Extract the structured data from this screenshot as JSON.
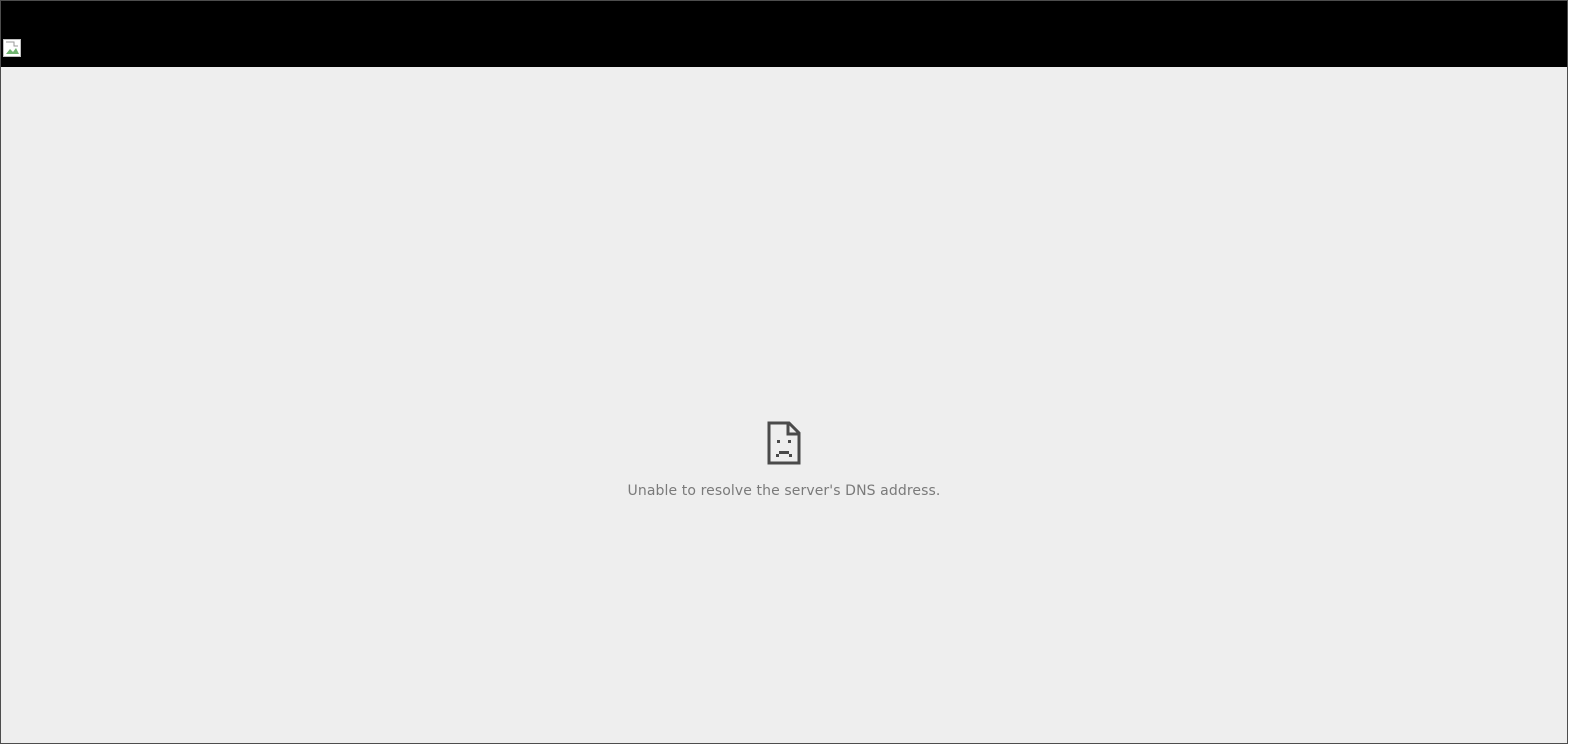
{
  "header": {
    "background_color": "#000000",
    "logo_icon": "broken-image-icon"
  },
  "error": {
    "icon": "sad-document-icon",
    "message": "Unable to resolve the server's DNS address."
  },
  "colors": {
    "page_background": "#eeeeee",
    "message_text": "#7a7a7a",
    "icon_stroke": "#4a4a4a"
  }
}
